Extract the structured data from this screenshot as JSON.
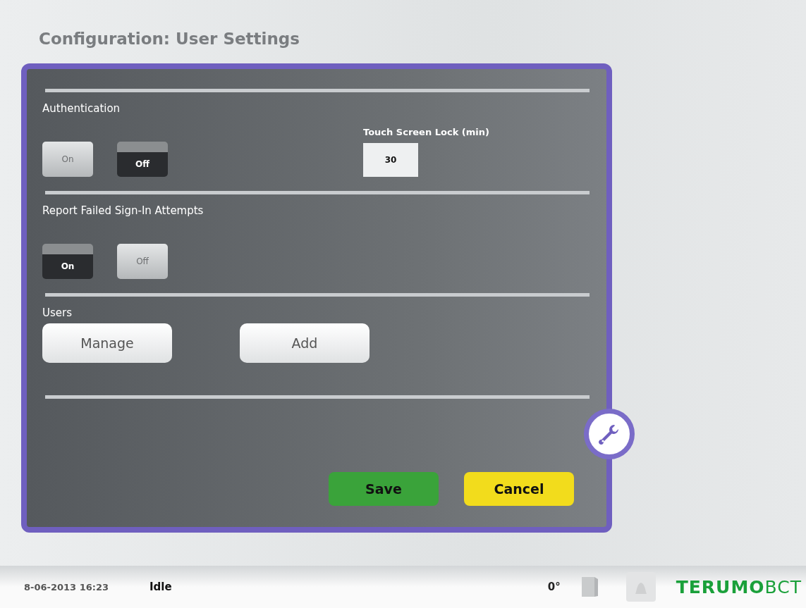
{
  "title": "Configuration: User Settings",
  "sections": [
    {
      "kind": "toggle",
      "heading": "Authentication",
      "options": [
        {
          "label": "On",
          "selected": false
        },
        {
          "label": "Off",
          "selected": true
        }
      ],
      "field": {
        "label": "Touch Screen Lock (min)",
        "value": "30"
      }
    },
    {
      "kind": "toggle",
      "heading": "Report Failed Sign-In Attempts",
      "options": [
        {
          "label": "On",
          "selected": true
        },
        {
          "label": "Off",
          "selected": false
        }
      ]
    },
    {
      "kind": "buttons",
      "heading": "Users",
      "buttons": [
        "Manage",
        "Add"
      ]
    }
  ],
  "actions": [
    {
      "label": "Save",
      "color": "#3aa33a"
    },
    {
      "label": "Cancel",
      "color": "#f2dc1c"
    }
  ],
  "status_bar": {
    "datetime": "8-06-2013 16:23",
    "state": "Idle",
    "tilt": "0°",
    "logo": "**TERUMO**BCT"
  }
}
